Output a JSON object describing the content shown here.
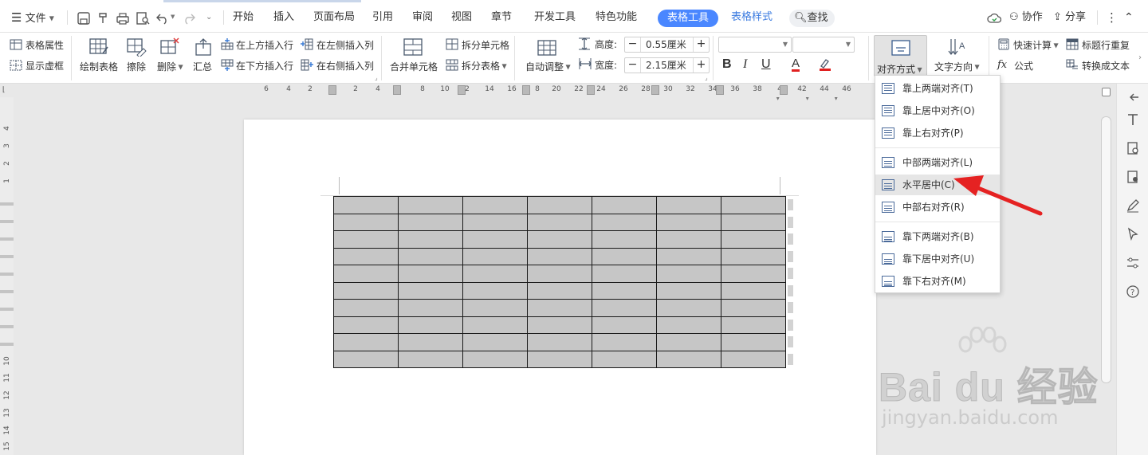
{
  "app": {
    "accent": "#4a87ff",
    "doc_bg": "#e8e8e8"
  },
  "menubar": {
    "file_label": "文件",
    "tabs": [
      {
        "label": "开始"
      },
      {
        "label": "插入"
      },
      {
        "label": "页面布局"
      },
      {
        "label": "引用"
      },
      {
        "label": "审阅"
      },
      {
        "label": "视图"
      },
      {
        "label": "章节"
      },
      {
        "label": "开发工具"
      },
      {
        "label": "特色功能"
      },
      {
        "label": "表格工具",
        "active": true
      },
      {
        "label": "表格样式"
      }
    ],
    "search_label": "查找",
    "collab_label": "协作",
    "share_label": "分享"
  },
  "ribbon": {
    "table_props": "表格属性",
    "show_gridlines": "显示虚框",
    "draw_table": "绘制表格",
    "erase": "擦除",
    "delete": "删除",
    "summary": "汇总",
    "insert_row_above": "在上方插入行",
    "insert_row_below": "在下方插入行",
    "insert_col_left": "在左侧插入列",
    "insert_col_right": "在右侧插入列",
    "merge_cells": "合并单元格",
    "split_cells": "拆分单元格",
    "split_table": "拆分表格",
    "auto_fit": "自动调整",
    "height_label": "高度:",
    "height_value": "0.55厘米",
    "width_label": "宽度:",
    "width_value": "2.15厘米",
    "font_name": "",
    "font_size": "",
    "align_label": "对齐方式",
    "text_direction": "文字方向",
    "quick_calc": "快速计算",
    "repeat_header": "标题行重复",
    "formula": "公式",
    "to_text": "转换成文本"
  },
  "ruler": {
    "h_ticks": [
      "6",
      "4",
      "2",
      "2",
      "4",
      "8",
      "10",
      "2",
      "14",
      "16",
      "8",
      "20",
      "22",
      "24",
      "26",
      "28",
      "30",
      "32",
      "34",
      "36",
      "38",
      "4",
      "42",
      "44",
      "46"
    ],
    "v_ticks": [
      "4",
      "3",
      "2",
      "1",
      "10",
      "11",
      "12",
      "13",
      "14",
      "15"
    ]
  },
  "table": {
    "rows": 10,
    "cols": 7
  },
  "align_menu": {
    "items": [
      {
        "label": "靠上两端对齐(T)",
        "group": "top"
      },
      {
        "label": "靠上居中对齐(O)",
        "group": "top"
      },
      {
        "label": "靠上右对齐(P)",
        "group": "top"
      },
      {
        "label": "中部两端对齐(L)",
        "group": "middle"
      },
      {
        "label": "水平居中(C)",
        "group": "middle",
        "highlighted": true
      },
      {
        "label": "中部右对齐(R)",
        "group": "middle"
      },
      {
        "label": "靠下两端对齐(B)",
        "group": "bottom"
      },
      {
        "label": "靠下居中对齐(U)",
        "group": "bottom"
      },
      {
        "label": "靠下右对齐(M)",
        "group": "bottom"
      }
    ]
  },
  "watermark": {
    "brand": "Bai du 经验",
    "url": "jingyan.baidu.com"
  },
  "annotation": {
    "arrow_color": "#e52222"
  }
}
